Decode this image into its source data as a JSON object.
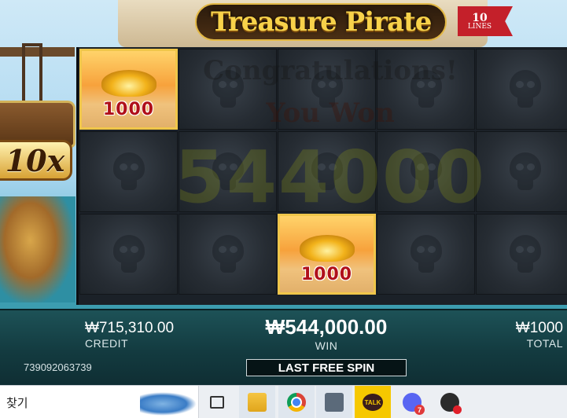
{
  "game": {
    "title": "Treasure Pirate",
    "lines_count": "10",
    "lines_label": "LINES",
    "multiplier": "10x"
  },
  "reels": {
    "columns": 5,
    "rows": 3,
    "winning_cells": [
      {
        "col": 0,
        "row": 0,
        "value": "1000"
      },
      {
        "col": 2,
        "row": 2,
        "value": "1000"
      }
    ]
  },
  "overlay": {
    "line1": "Congratulations!",
    "line2": "You Won",
    "amount": "544000"
  },
  "bottom_bar": {
    "credit_value": "₩715,310.00",
    "credit_label": "CREDIT",
    "win_value": "₩544,000.00",
    "win_label": "WIN",
    "total_value": "₩1000",
    "total_label": "TOTAL",
    "game_id": "739092063739",
    "spin_status": "LAST FREE SPIN"
  },
  "taskbar": {
    "search_placeholder": "찾기",
    "talk_label": "TALK",
    "discord_badge": "7"
  },
  "colors": {
    "win_cell_border": "#f0c64a",
    "win_value_text": "#b0101a",
    "bottom_bar": "#133b40",
    "kakaotalk": "#f6c800"
  }
}
